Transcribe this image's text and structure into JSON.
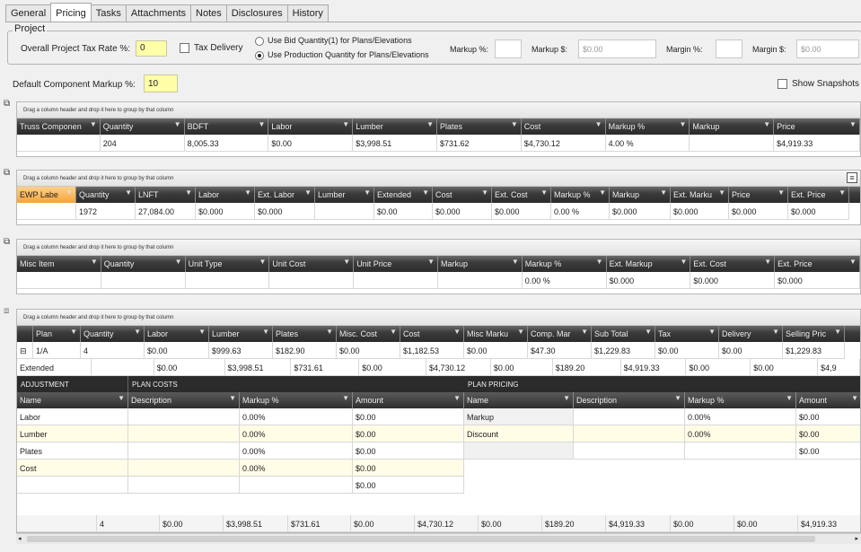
{
  "tabs": [
    "General",
    "Pricing",
    "Tasks",
    "Attachments",
    "Notes",
    "Disclosures",
    "History"
  ],
  "project": {
    "group_title": "Project",
    "tax_rate_label": "Overall Project Tax Rate %:",
    "tax_rate_value": "0",
    "tax_delivery_label": "Tax Delivery",
    "radio_bid": "Use Bid Quantity(1) for Plans/Elevations",
    "radio_production": "Use Production Quantity for Plans/Elevations",
    "markup_pct_label": "Markup %:",
    "markup_dollar_label": "Markup $:",
    "markup_dollar_value": "$0.00",
    "margin_pct_label": "Margin %:",
    "margin_dollar_label": "Margin $:",
    "margin_dollar_value": "$0.00"
  },
  "default_markup": {
    "label": "Default Component Markup %:",
    "value": "10"
  },
  "show_snapshots": "Show Snapshots",
  "drag_hint": "Drag a column header and drop it here to group by that column",
  "truss": {
    "headers": [
      "Truss Componen",
      "Quantity",
      "BDFT",
      "Labor",
      "Lumber",
      "Plates",
      "Cost",
      "Markup %",
      "Markup",
      "Price"
    ],
    "row": [
      "",
      "204",
      "8,005.33",
      "$0.00",
      "$3,998.51",
      "$731.62",
      "$4,730.12",
      "4.00 %",
      "",
      "$4,919.33"
    ]
  },
  "ewp": {
    "headers": [
      "EWP Labe",
      "Quantity",
      "LNFT",
      "Labor",
      "Ext. Labor",
      "Lumber",
      "Extended",
      "Cost",
      "Ext. Cost",
      "Markup %",
      "Markup",
      "Ext. Marku",
      "Price",
      "Ext. Price"
    ],
    "row": [
      "",
      "1972",
      "27,084.00",
      "$0.000",
      "$0.000",
      "",
      "$0.00",
      "$0.000",
      "$0.000",
      "0.00 %",
      "$0.000",
      "$0.000",
      "$0.000",
      "$0.000"
    ]
  },
  "misc": {
    "headers": [
      "Misc Item",
      "Quantity",
      "Unit Type",
      "Unit Cost",
      "Unit Price",
      "Markup",
      "Markup %",
      "Ext. Markup",
      "Ext. Cost",
      "Ext. Price"
    ],
    "row": [
      "",
      "",
      "",
      "",
      "",
      "",
      "0.00 %",
      "$0.000",
      "$0.000",
      "$0.000"
    ]
  },
  "plans": {
    "headers": [
      "Plan",
      "Quantity",
      "Labor",
      "Lumber",
      "Plates",
      "Misc. Cost",
      "Cost",
      "Misc Marku",
      "Comp. Mar",
      "Sub Total",
      "Tax",
      "Delivery",
      "Selling Pric"
    ],
    "row": [
      "1/A",
      "4",
      "$0.00",
      "$999.63",
      "$182.90",
      "$0.00",
      "$1,182.53",
      "$0.00",
      "$47.30",
      "$1,229.83",
      "$0.00",
      "$0.00",
      "$1,229.83"
    ],
    "extended": [
      "Extended",
      "",
      "$0.00",
      "$3,998.51",
      "$731.61",
      "$0.00",
      "$4,730.12",
      "$0.00",
      "$189.20",
      "$4,919.33",
      "$0.00",
      "$0.00",
      "$4,9"
    ],
    "footer": [
      "",
      "4",
      "$0.00",
      "$3,998.51",
      "$731.61",
      "$0.00",
      "$4,730.12",
      "$0.00",
      "$189.20",
      "$4,919.33",
      "$0.00",
      "$0.00",
      "$4,919.33"
    ]
  },
  "adjust": {
    "sections": [
      "ADJUSTMENT",
      "PLAN COSTS",
      "PLAN PRICING"
    ],
    "cost_headers": [
      "Name",
      "Description",
      "Markup %",
      "Amount"
    ],
    "cost_rows": [
      [
        "Labor",
        "",
        "0.00%",
        "$0.00"
      ],
      [
        "Lumber",
        "",
        "0.00%",
        "$0.00"
      ],
      [
        "Plates",
        "",
        "0.00%",
        "$0.00"
      ],
      [
        "Cost",
        "",
        "0.00%",
        "$0.00"
      ],
      [
        "",
        "",
        "",
        "$0.00"
      ]
    ],
    "pricing_headers": [
      "Name",
      "Description",
      "Markup %",
      "Amount"
    ],
    "pricing_rows": [
      [
        "Markup",
        "",
        "0.00%",
        "$0.00"
      ],
      [
        "Discount",
        "",
        "0.00%",
        "$0.00"
      ],
      [
        "",
        "",
        "",
        "$0.00"
      ]
    ]
  }
}
